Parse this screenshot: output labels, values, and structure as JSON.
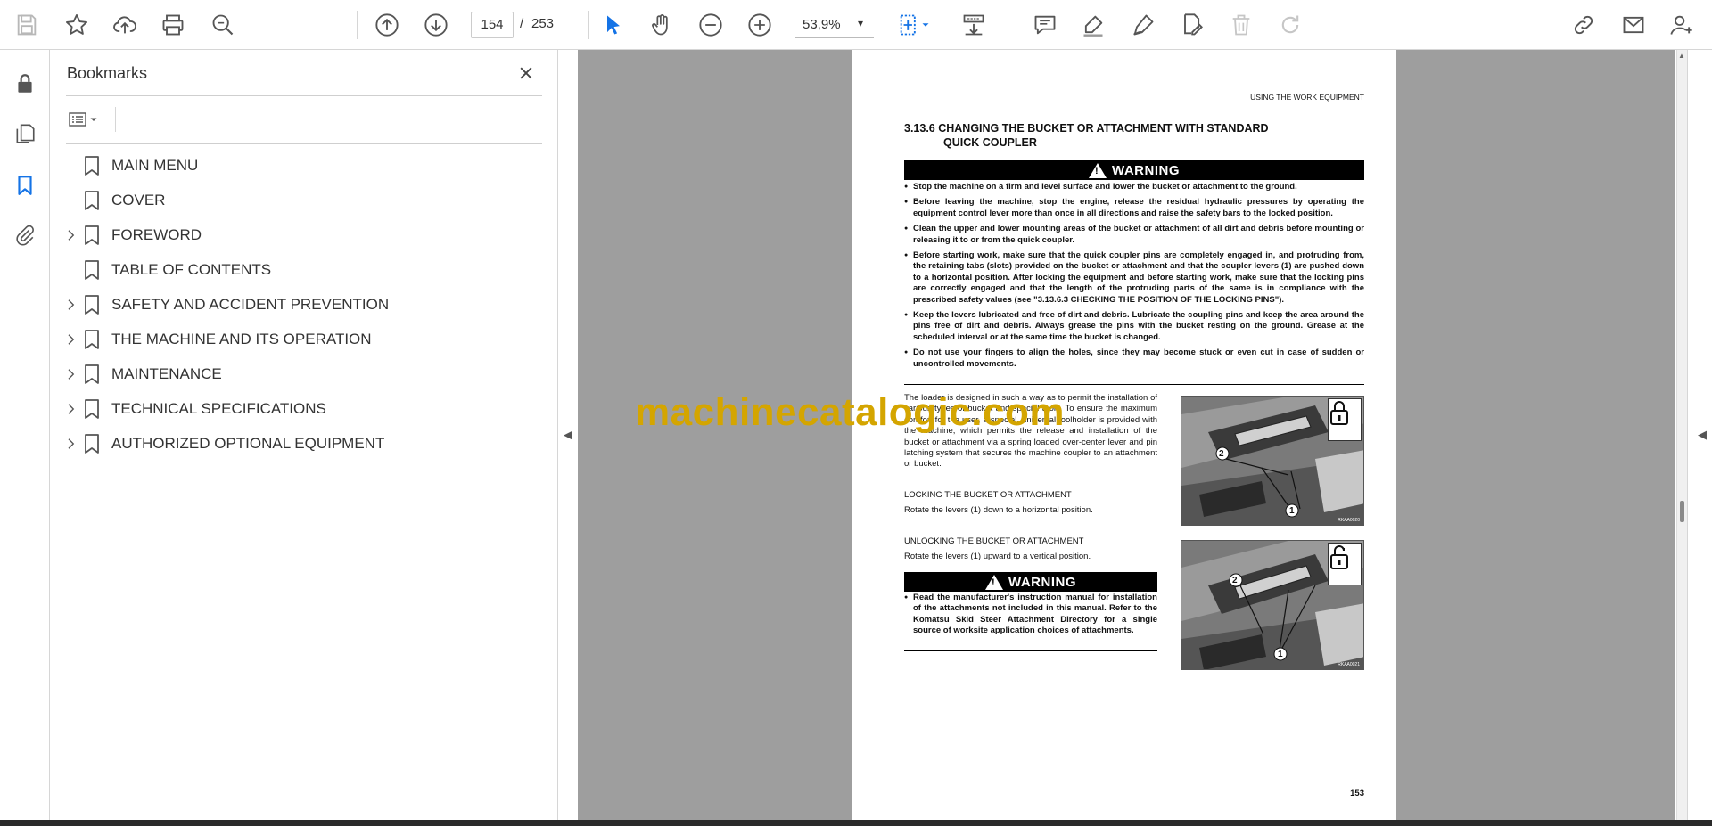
{
  "toolbar": {
    "page_current": "154",
    "page_separator": "/",
    "page_total": "253",
    "zoom": "53,9%"
  },
  "bookmarks": {
    "title": "Bookmarks",
    "items": [
      {
        "label": "MAIN MENU",
        "expandable": false
      },
      {
        "label": "COVER",
        "expandable": false
      },
      {
        "label": "FOREWORD",
        "expandable": true
      },
      {
        "label": "TABLE OF CONTENTS",
        "expandable": false
      },
      {
        "label": "SAFETY AND ACCIDENT PREVENTION",
        "expandable": true
      },
      {
        "label": "THE MACHINE AND ITS OPERATION",
        "expandable": true
      },
      {
        "label": "MAINTENANCE",
        "expandable": true
      },
      {
        "label": "TECHNICAL SPECIFICATIONS",
        "expandable": true
      },
      {
        "label": "AUTHORIZED OPTIONAL EQUIPMENT",
        "expandable": true
      }
    ]
  },
  "document": {
    "header": "USING THE WORK EQUIPMENT",
    "section_line1": "3.13.6 CHANGING THE BUCKET OR ATTACHMENT WITH STANDARD",
    "section_line2": "QUICK COUPLER",
    "warning_label": "WARNING",
    "warnings": [
      "Stop the machine on a firm and level surface and lower the bucket or attachment to the ground.",
      "Before leaving the machine, stop the engine, release the residual hydraulic pressures by operating the equipment control lever more than once in all directions and raise the safety bars to the locked position.",
      "Clean the upper and lower mounting areas of the bucket or attachment of all dirt and debris before mounting or releasing it to or from the quick coupler.",
      "Before starting work, make sure that the quick coupler pins are completely engaged in, and protruding from, the retaining tabs (slots) provided on the bucket or attachment and that the coupler levers (1) are pushed down to a horizontal position. After locking the equipment and before starting work, make sure that the locking pins are correctly engaged and that the length of the protruding parts of the same is in compliance with the prescribed safety values (see \"3.13.6.3 CHECKING THE POSITION OF THE LOCKING PINS\").",
      "Keep the levers lubricated and free of dirt and debris. Lubricate the coupling pins and keep the area around the pins free of dirt and debris. Always grease the pins with the bucket resting on the ground. Grease at the scheduled interval or at the same time the bucket is changed.",
      "Do not use your fingers to align the holes, since they may become stuck or even cut in case of sudden or uncontrolled movements."
    ],
    "intro": "The loader is designed in such a way as to permit the installation of various types of bucket and special tools. To ensure the maximum comfort for the user, a special, universal toolholder is provided with the machine, which permits the release and installation of the bucket or attachment via a spring loaded over-center lever and pin latching system that secures the machine coupler to an attachment or bucket.",
    "locking_title": "LOCKING THE BUCKET OR ATTACHMENT",
    "locking_text": "Rotate the levers (1) down to a horizontal position.",
    "unlocking_title": "UNLOCKING THE BUCKET OR ATTACHMENT",
    "unlocking_text": "Rotate the levers (1) upward to a vertical position.",
    "warning2": "Read the manufacturer's instruction manual for installation of the attachments not included in this manual. Refer to the Komatsu Skid Steer Attachment Directory for a single source of worksite application choices of attachments.",
    "photo1_code": "RKAA0020",
    "photo2_code": "RKAA0021",
    "callout_1": "1",
    "callout_2": "2",
    "page_number": "153"
  },
  "watermark": "machinecatalogic.com",
  "colors": {
    "accent_blue": "#1473e6",
    "icon_gray": "#555555",
    "viewer_bg": "#9e9e9e",
    "watermark": "#d4a500"
  }
}
